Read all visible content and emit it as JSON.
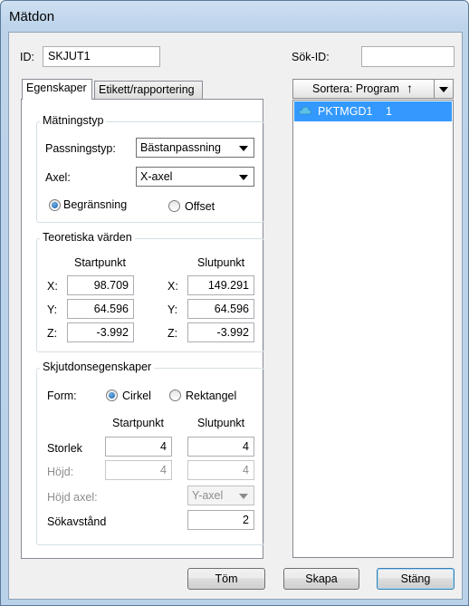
{
  "window": {
    "title": "Mätdon"
  },
  "header": {
    "id_label": "ID:",
    "id_value": "SKJUT1",
    "search_label": "Sök-ID:",
    "search_value": ""
  },
  "tabs": [
    {
      "label": "Egenskaper",
      "active": true
    },
    {
      "label": "Etikett/rapportering",
      "active": false
    }
  ],
  "measure_type": {
    "group_title": "Mätningstyp",
    "fit_label": "Passningstyp:",
    "fit_value": "Bästanpassning",
    "axis_label": "Axel:",
    "axis_value": "X-axel",
    "radio_limit": "Begränsning",
    "radio_offset": "Offset",
    "selected": "Begränsning"
  },
  "theoretical": {
    "group_title": "Teoretiska värden",
    "start_header": "Startpunkt",
    "end_header": "Slutpunkt",
    "rows": [
      {
        "label": "X:",
        "start": "98.709",
        "end": "149.291"
      },
      {
        "label": "Y:",
        "start": "64.596",
        "end": "64.596"
      },
      {
        "label": "Z:",
        "start": "-3.992",
        "end": "-3.992"
      }
    ]
  },
  "probe": {
    "group_title": "Skjutdonsegenskaper",
    "form_label": "Form:",
    "radio_circle": "Cirkel",
    "radio_rect": "Rektangel",
    "selected": "Cirkel",
    "start_header": "Startpunkt",
    "end_header": "Slutpunkt",
    "size_label": "Storlek",
    "size_start": "4",
    "size_end": "4",
    "height_label": "Höjd:",
    "height_start": "4",
    "height_end": "4",
    "height_axis_label": "Höjd axel:",
    "height_axis_value": "Y-axel",
    "search_dist_label": "Sökavstånd",
    "search_dist_value": "2"
  },
  "list": {
    "sort_label": "Sortera: Program",
    "sort_arrow": "↑",
    "items": [
      {
        "name": "PKTMGD1",
        "count": "1",
        "icon": "cloud-icon"
      }
    ]
  },
  "buttons": {
    "clear": "Töm",
    "create": "Skapa",
    "close": "Stäng"
  },
  "colors": {
    "selection": "#3399ff",
    "title_bar": "#bcd3ea"
  }
}
